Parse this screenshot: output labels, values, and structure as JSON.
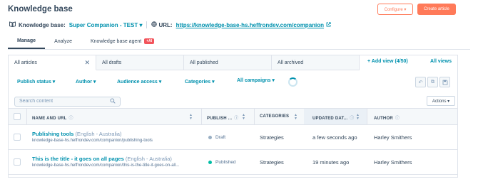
{
  "header": {
    "title": "Knowledge base",
    "configure_label": "Configure ▾",
    "create_label": "Create article"
  },
  "kb": {
    "label": "Knowledge base:",
    "selected": "Super Companion - TEST ▾",
    "url_label": "URL:",
    "url": "https://knowledge-base-hs.heffrondev.com/companion"
  },
  "tabs": [
    {
      "label": "Manage"
    },
    {
      "label": "Analyze"
    },
    {
      "label": "Knowledge base agent",
      "badge": "+AI"
    }
  ],
  "views": [
    {
      "label": "All articles"
    },
    {
      "label": "All drafts"
    },
    {
      "label": "All published"
    },
    {
      "label": "All archived"
    }
  ],
  "add_view_label": "+ Add view (4/50)",
  "all_views_label": "All views",
  "filters": {
    "publish_status": "Publish status ▾",
    "author": "Author ▾",
    "audience_access": "Audience access ▾",
    "categories": "Categories ▾",
    "all_campaigns": "All campaigns ▾"
  },
  "search": {
    "placeholder": "Search content"
  },
  "actions_label": "Actions ▾",
  "columns": {
    "name": "NAME AND URL",
    "publish": "PUBLISH ...",
    "categories": "CATEGORIES",
    "updated": "UPDATED DAT...",
    "author": "AUTHOR"
  },
  "rows": [
    {
      "title": "Publishing tools",
      "lang": "(English - Australia)",
      "url": "knowledge-base-hs.heffrondev.com/companion/publishing-tools",
      "status": "Draft",
      "status_color": "#99afc4",
      "category": "Strategies",
      "updated": "a few seconds ago",
      "author": "Harley Smithers"
    },
    {
      "title": "This is the title - it goes on all pages",
      "lang": "(English - Australia)",
      "url": "knowledge-base-hs.heffrondev.com/companion/this-is-the-title-it-goes-on-all...",
      "status": "Published",
      "status_color": "#00bda5",
      "category": "Strategies",
      "updated": "19 minutes ago",
      "author": "Harley Smithers"
    }
  ]
}
